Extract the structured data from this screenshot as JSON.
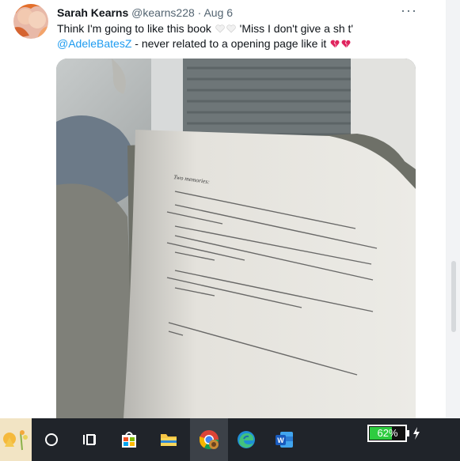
{
  "tweet": {
    "display_name": "Sarah Kearns",
    "handle": "@kearns228",
    "separator": "·",
    "date": "Aug 6",
    "more": "···",
    "line1": "Think I'm going to like this book",
    "line1_quote": "'Miss I don't give a sh t'",
    "mention": "@AdeleBatesZ",
    "line2": "- never related to a opening page like it"
  },
  "taskbar": {
    "battery_percent": "62%",
    "icons": [
      "weather-widget-icon",
      "start-icon",
      "task-view-icon",
      "store-icon",
      "file-explorer-icon",
      "chrome-icon",
      "edge-icon",
      "word-icon",
      "battery-icon",
      "charging-icon"
    ]
  },
  "colors": {
    "accent": "#1d9bf0",
    "heart_broken": "#e0245e",
    "taskbar_bg": "#20242a",
    "battery_fill": "#2ecc40"
  }
}
